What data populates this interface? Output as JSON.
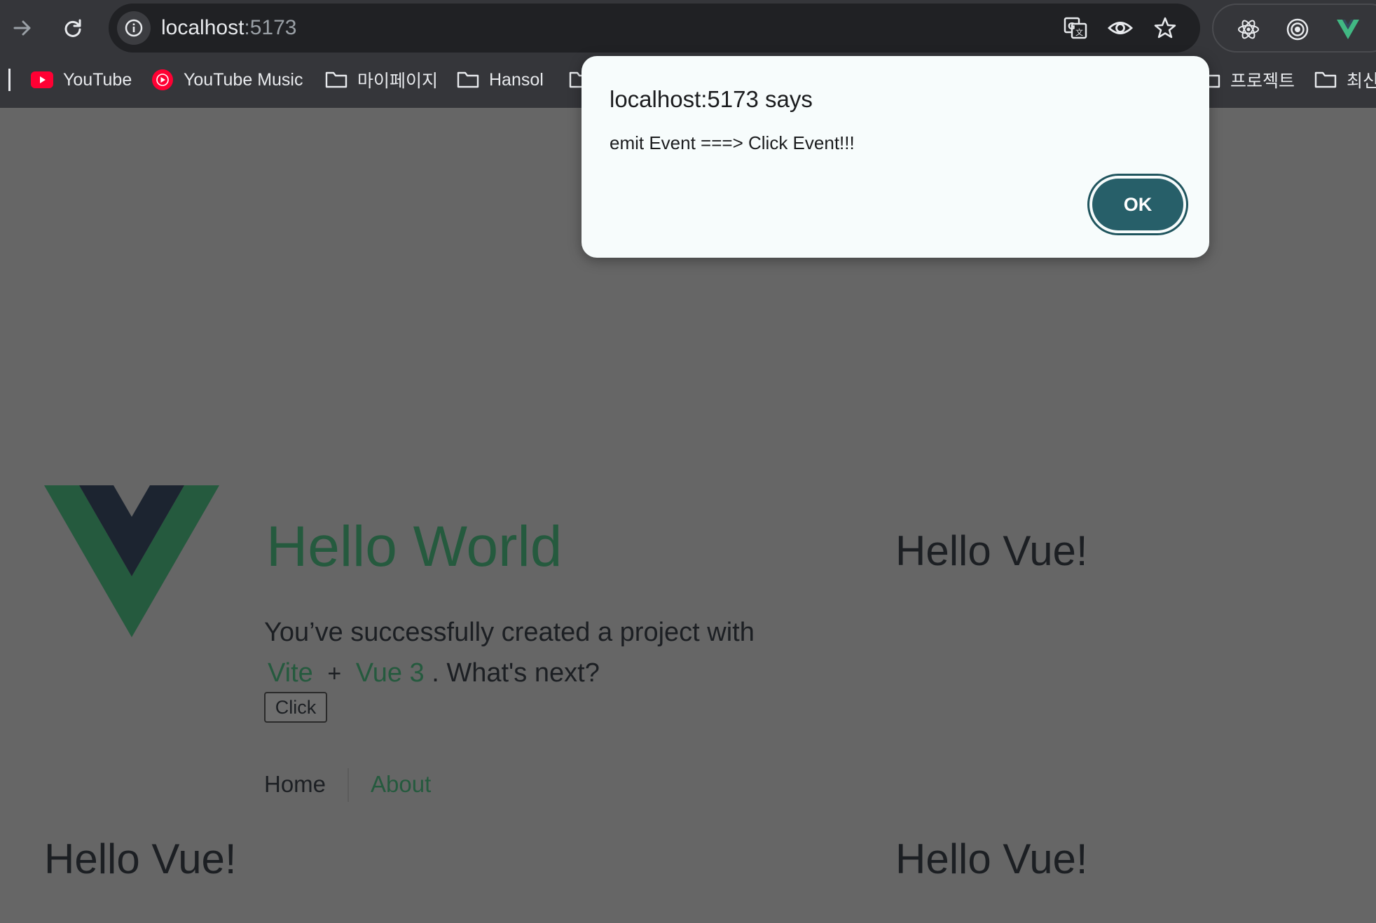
{
  "browser": {
    "url_host": "localhost",
    "url_port": ":5173",
    "bookmarks": [
      {
        "label": "YouTube",
        "icon": "youtube-icon"
      },
      {
        "label": "YouTube Music",
        "icon": "youtube-music-icon"
      },
      {
        "label": "마이페이지",
        "icon": "folder-icon"
      },
      {
        "label": "Hansol",
        "icon": "folder-icon"
      },
      {
        "label": "프로젝트",
        "icon": "folder-icon"
      },
      {
        "label": "최신",
        "icon": "folder-icon"
      }
    ],
    "extensions": [
      "react-devtools-icon",
      "target-icon",
      "vue-devtools-icon"
    ]
  },
  "dialog": {
    "title": "localhost:5173 says",
    "message": "emit Event ===> Click Event!!!",
    "ok_label": "OK"
  },
  "page": {
    "heading": "Hello World",
    "line1": "You’ve successfully created a project with",
    "vite_link": "Vite",
    "plus": "+",
    "vue_link": "Vue 3",
    "line2_rest": ". What's next?",
    "click_label": "Click",
    "nav": {
      "home": "Home",
      "about": "About"
    },
    "hello_vue_1": "Hello Vue!",
    "hello_vue_2": "Hello Vue!",
    "hello_vue_3": "Hello Vue!"
  },
  "colors": {
    "vue_green": "#255a3e",
    "vue_dark": "#1c2430",
    "ok_button": "#275f69"
  }
}
